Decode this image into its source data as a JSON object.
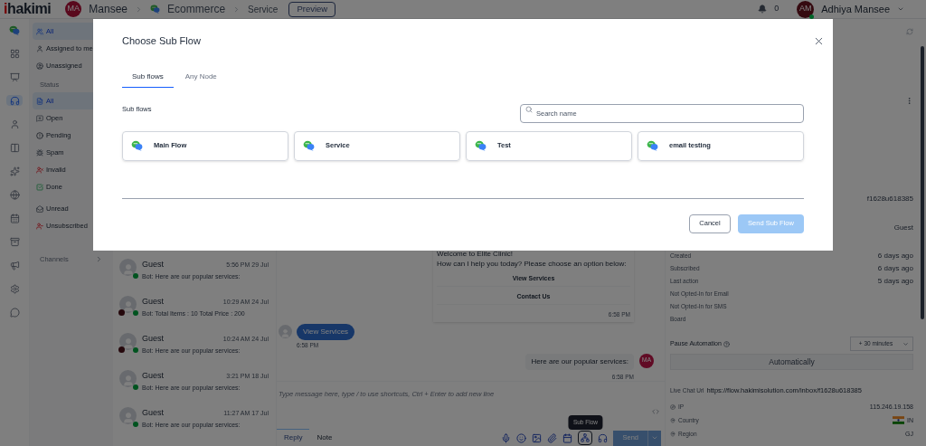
{
  "top_bar": {
    "logo": "ihakimi",
    "workspace": {
      "initials": "MA",
      "name": "Mansee"
    },
    "breadcrumb": [
      "Ecommerce",
      "Service"
    ],
    "preview_button": "Preview",
    "notifications": "0",
    "user": {
      "initials": "AM",
      "name": "Adhiya Mansee",
      "online": true
    }
  },
  "rail": [
    {
      "selected": false
    },
    {
      "selected": false
    },
    {
      "selected": false
    },
    {
      "selected": true
    },
    {
      "selected": false
    },
    {
      "selected": false
    },
    {
      "selected": false
    },
    {
      "selected": false
    },
    {
      "selected": false
    },
    {
      "selected": false
    },
    {
      "selected": false
    },
    {
      "selected": false
    },
    {
      "selected": false
    }
  ],
  "filters": [
    {
      "label": "All",
      "selected": true
    },
    {
      "label": "Assigned to me",
      "selected": false
    },
    {
      "label": "Unassigned",
      "selected": false
    }
  ],
  "status_heading": "Status",
  "status_filters": [
    {
      "label": "All",
      "selected": true
    },
    {
      "label": "Open",
      "selected": false
    },
    {
      "label": "Pending",
      "selected": false
    },
    {
      "label": "Spam",
      "selected": false
    },
    {
      "label": "Invalid",
      "selected": false
    },
    {
      "label": "Done",
      "selected": false
    }
  ],
  "extra_filters": [
    {
      "label": "Unread",
      "selected": false
    },
    {
      "label": "Unsubscribed",
      "selected": false
    }
  ],
  "channels": "Channels",
  "chat_list": [
    {
      "name": "Guest",
      "time": "5:56 PM 29 Jul",
      "preview": "Bot: Here are our popular services:",
      "assigned": false
    },
    {
      "name": "Guest",
      "time": "10:29 AM 24 Jul",
      "preview": "Bot: Total Items : 10 Total Price : 200",
      "assigned": true
    },
    {
      "name": "Guest",
      "time": "10:24 AM 24 Jul",
      "preview": "Bot: Here are our popular services:",
      "assigned": true
    },
    {
      "name": "Guest",
      "time": "3:21 PM 18 Jul",
      "preview": "Bot: Here are our popular services:",
      "assigned": false
    },
    {
      "name": "Guest",
      "time": "11:27 AM 17 Jul",
      "preview": "Bot: Here are our popular services:",
      "assigned": false
    }
  ],
  "conversation": {
    "bot_message": {
      "lines": [
        "Welcome to Elite Clinic!",
        "How can I help you today? Please choose an option below:"
      ],
      "buttons": [
        "View Services",
        "Contact Us"
      ],
      "time": "6:58 PM"
    },
    "user_message": {
      "text": "View Services",
      "time": "6:58 PM"
    },
    "agent_message": {
      "text": "Here are our popular services:",
      "initials": "MA",
      "time": "6:58 PM"
    }
  },
  "composer": {
    "placeholder": "Type message here, type / to use shortcuts, Ctrl + Enter to add new line",
    "tabs": [
      {
        "label": "Reply",
        "selected": true
      },
      {
        "label": "Note",
        "selected": false
      }
    ],
    "tooltip": "Sub Flow",
    "tools": [
      {
        "selected": false
      },
      {
        "selected": false
      },
      {
        "selected": false
      },
      {
        "selected": false
      },
      {
        "selected": false
      },
      {
        "selected": true
      },
      {
        "selected": false
      }
    ],
    "send": {
      "label": "Send",
      "disabled": true
    }
  },
  "contact": {
    "id": "f1628u618385",
    "name": "Guest",
    "rows": [
      {
        "label": "Created",
        "value": "6 days ago"
      },
      {
        "label": "Subscribed",
        "value": "6 days ago"
      },
      {
        "label": "Last action",
        "value": "5 days ago"
      }
    ],
    "opt_in": [
      "Not Opted-In for Email",
      "Not Opted-In for SMS"
    ],
    "board": "Board",
    "pause": {
      "label": "Pause Automation",
      "select": "+ 30 minutes",
      "button": "Automatically"
    },
    "live_chat": {
      "label": "Live Chat Url",
      "url": "https://flow.hakimisolution.com/inbox/f1628u618385"
    },
    "location": [
      {
        "label": "IP",
        "value": "115.246.19.158",
        "kind": "text"
      },
      {
        "label": "Country",
        "value": "IN",
        "kind": "flag"
      },
      {
        "label": "Region",
        "value": "GJ",
        "kind": "text"
      }
    ]
  },
  "modal": {
    "title": "Choose Sub Flow",
    "tabs": [
      {
        "label": "Sub flows",
        "selected": true
      },
      {
        "label": "Any Node",
        "selected": false
      }
    ],
    "section_label": "Sub flows",
    "search": {
      "placeholder": "Search name"
    },
    "flows": [
      "Main Flow",
      "Service",
      "Test",
      "email testing"
    ],
    "cancel": "Cancel",
    "submit": {
      "label": "Send Sub Flow",
      "disabled": true
    }
  }
}
